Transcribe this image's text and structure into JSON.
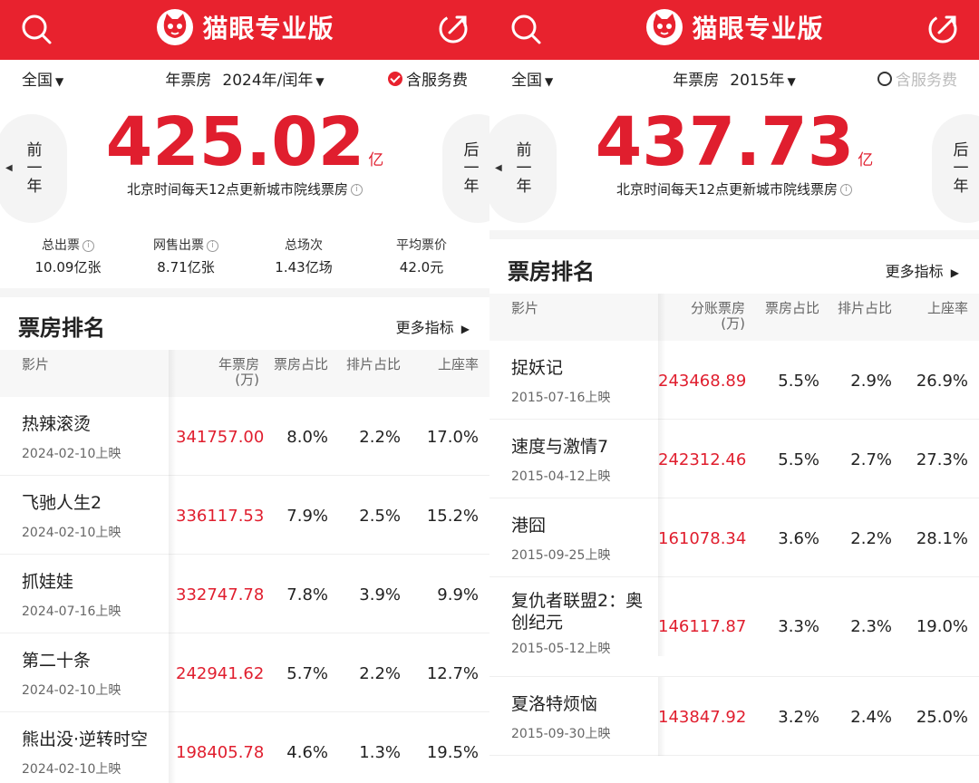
{
  "app": {
    "brand_title": "猫眼专业版",
    "accent_color": "#e8222e",
    "icons": [
      "search-icon",
      "share-icon",
      "cat-logo-icon",
      "info-icon",
      "checkbox-icon"
    ]
  },
  "left": {
    "region": "全国",
    "year_label": "年票房",
    "year_value": "2024年/闰年",
    "service_fee": "含服务费",
    "service_fee_checked": true,
    "prev_btn": [
      "前",
      "一",
      "年"
    ],
    "next_btn": [
      "后",
      "一",
      "年"
    ],
    "total": "425.02",
    "total_unit": "亿",
    "note": "北京时间每天12点更新城市院线票房",
    "stats": [
      {
        "label": "总出票",
        "value": "10.09亿张"
      },
      {
        "label": "网售出票",
        "value": "8.71亿张"
      },
      {
        "label": "总场次",
        "value": "1.43亿场"
      },
      {
        "label": "平均票价",
        "value": "42.0元"
      }
    ],
    "section_title": "票房排名",
    "more_label": "更多指标",
    "headers": {
      "film": "影片",
      "gross": "年票房",
      "gross_unit": "(万)",
      "share": "票房占比",
      "sched": "排片占比",
      "occ": "上座率"
    },
    "rows": [
      {
        "name": "热辣滚烫",
        "date": "2024-02-10上映",
        "gross": "341757.00",
        "share": "8.0%",
        "sched": "2.2%",
        "occ": "17.0%"
      },
      {
        "name": "飞驰人生2",
        "date": "2024-02-10上映",
        "gross": "336117.53",
        "share": "7.9%",
        "sched": "2.5%",
        "occ": "15.2%"
      },
      {
        "name": "抓娃娃",
        "date": "2024-07-16上映",
        "gross": "332747.78",
        "share": "7.8%",
        "sched": "3.9%",
        "occ": "9.9%"
      },
      {
        "name": "第二十条",
        "date": "2024-02-10上映",
        "gross": "242941.62",
        "share": "5.7%",
        "sched": "2.2%",
        "occ": "12.7%"
      },
      {
        "name": "熊出没·逆转时空",
        "date": "2024-02-10上映",
        "gross": "198405.78",
        "share": "4.6%",
        "sched": "1.3%",
        "occ": "19.5%"
      }
    ]
  },
  "right": {
    "region": "全国",
    "year_label": "年票房",
    "year_value": "2015年",
    "service_fee": "含服务费",
    "service_fee_checked": false,
    "prev_btn": [
      "前",
      "一",
      "年"
    ],
    "next_btn": [
      "后",
      "一",
      "年"
    ],
    "total": "437.73",
    "total_unit": "亿",
    "note": "北京时间每天12点更新城市院线票房",
    "section_title": "票房排名",
    "more_label": "更多指标",
    "headers": {
      "film": "影片",
      "gross": "分账票房",
      "gross_unit": "(万)",
      "share": "票房占比",
      "sched": "排片占比",
      "occ": "上座率"
    },
    "rows": [
      {
        "name": "捉妖记",
        "date": "2015-07-16上映",
        "gross": "243468.89",
        "share": "5.5%",
        "sched": "2.9%",
        "occ": "26.9%"
      },
      {
        "name": "速度与激情7",
        "date": "2015-04-12上映",
        "gross": "242312.46",
        "share": "5.5%",
        "sched": "2.7%",
        "occ": "27.3%"
      },
      {
        "name": "港囧",
        "date": "2015-09-25上映",
        "gross": "161078.34",
        "share": "3.6%",
        "sched": "2.2%",
        "occ": "28.1%"
      },
      {
        "name": "复仇者联盟2：奥创纪元",
        "date": "2015-05-12上映",
        "gross": "146117.87",
        "share": "3.3%",
        "sched": "2.3%",
        "occ": "19.0%"
      },
      {
        "name": "夏洛特烦恼",
        "date": "2015-09-30上映",
        "gross": "143847.92",
        "share": "3.2%",
        "sched": "2.4%",
        "occ": "25.0%"
      }
    ]
  }
}
